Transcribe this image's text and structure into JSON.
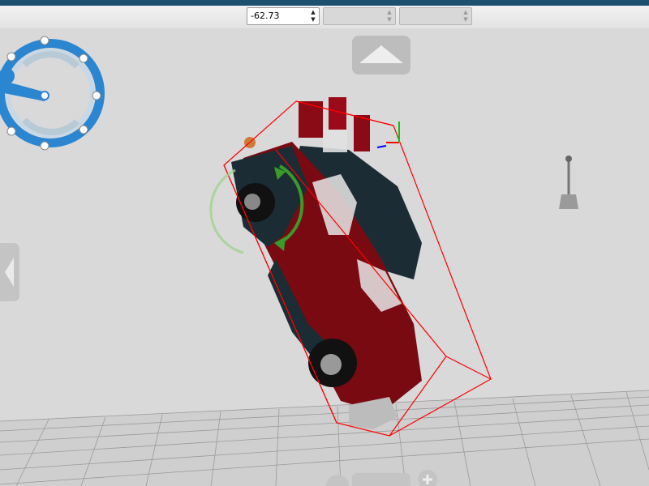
{
  "toolbar": {
    "rotation_value": "-62.73",
    "field2_value": "",
    "field3_value": ""
  },
  "icons": {
    "rotate_widget": "rotate-camera-icon",
    "pan_up": "arrow-up-icon",
    "pan_left": "arrow-left-icon",
    "lever": "joystick-lever-icon",
    "zoom_out": "zoom-out-icon",
    "zoom_in": "zoom-in-icon"
  },
  "colors": {
    "title_bar": "#1d4f6f",
    "selection_box": "#ff0000",
    "rotate_handle": "#3a9a2a",
    "brick_red": "#7a0a12",
    "brick_dark": "#1b2c35",
    "widget_blue": "#2a86d0"
  }
}
